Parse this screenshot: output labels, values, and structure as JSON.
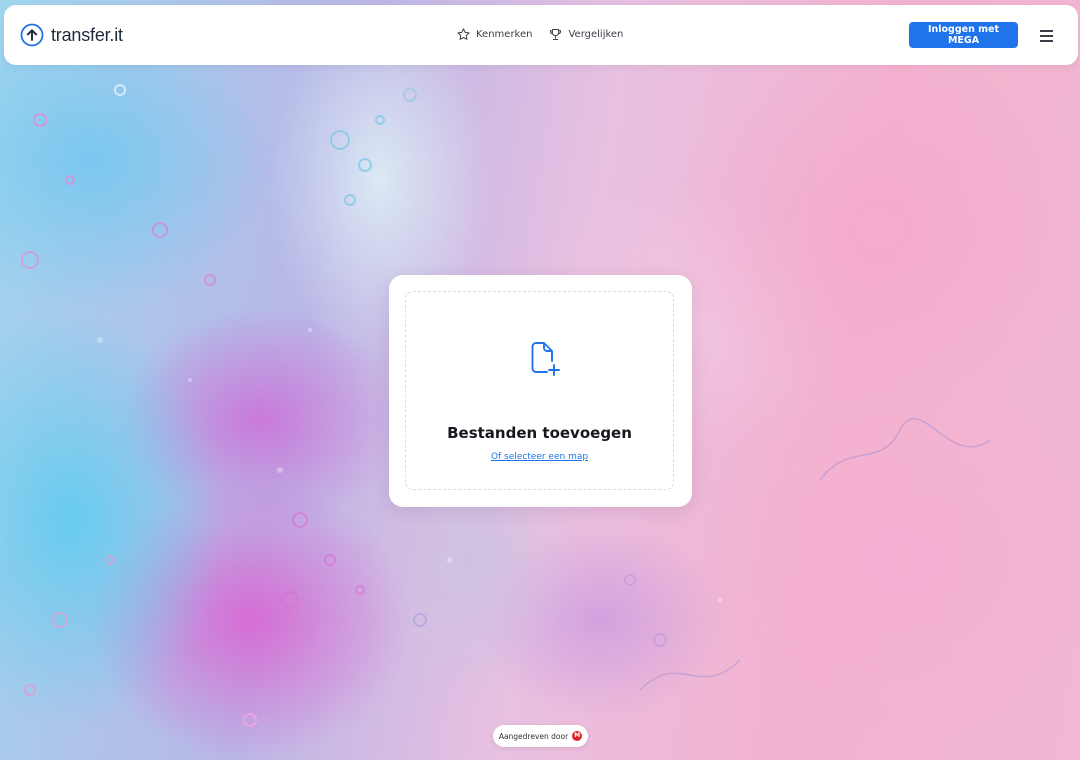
{
  "header": {
    "logo_text": "transfer.it",
    "nav": [
      {
        "label": "Kenmerken",
        "icon": "star-icon"
      },
      {
        "label": "Vergelijken",
        "icon": "trophy-icon"
      }
    ],
    "login_label": "Inloggen met MEGA",
    "menu_icon": "hamburger-menu-icon"
  },
  "upload": {
    "icon": "file-add-icon",
    "title": "Bestanden toevoegen",
    "folder_link": "Of selecteer een map"
  },
  "footer": {
    "powered_by": "Aangedreven door",
    "badge_letter": "M",
    "badge_icon": "mega-logo-icon"
  },
  "colors": {
    "accent": "#1f74ec",
    "mega_red": "#d9272e"
  }
}
